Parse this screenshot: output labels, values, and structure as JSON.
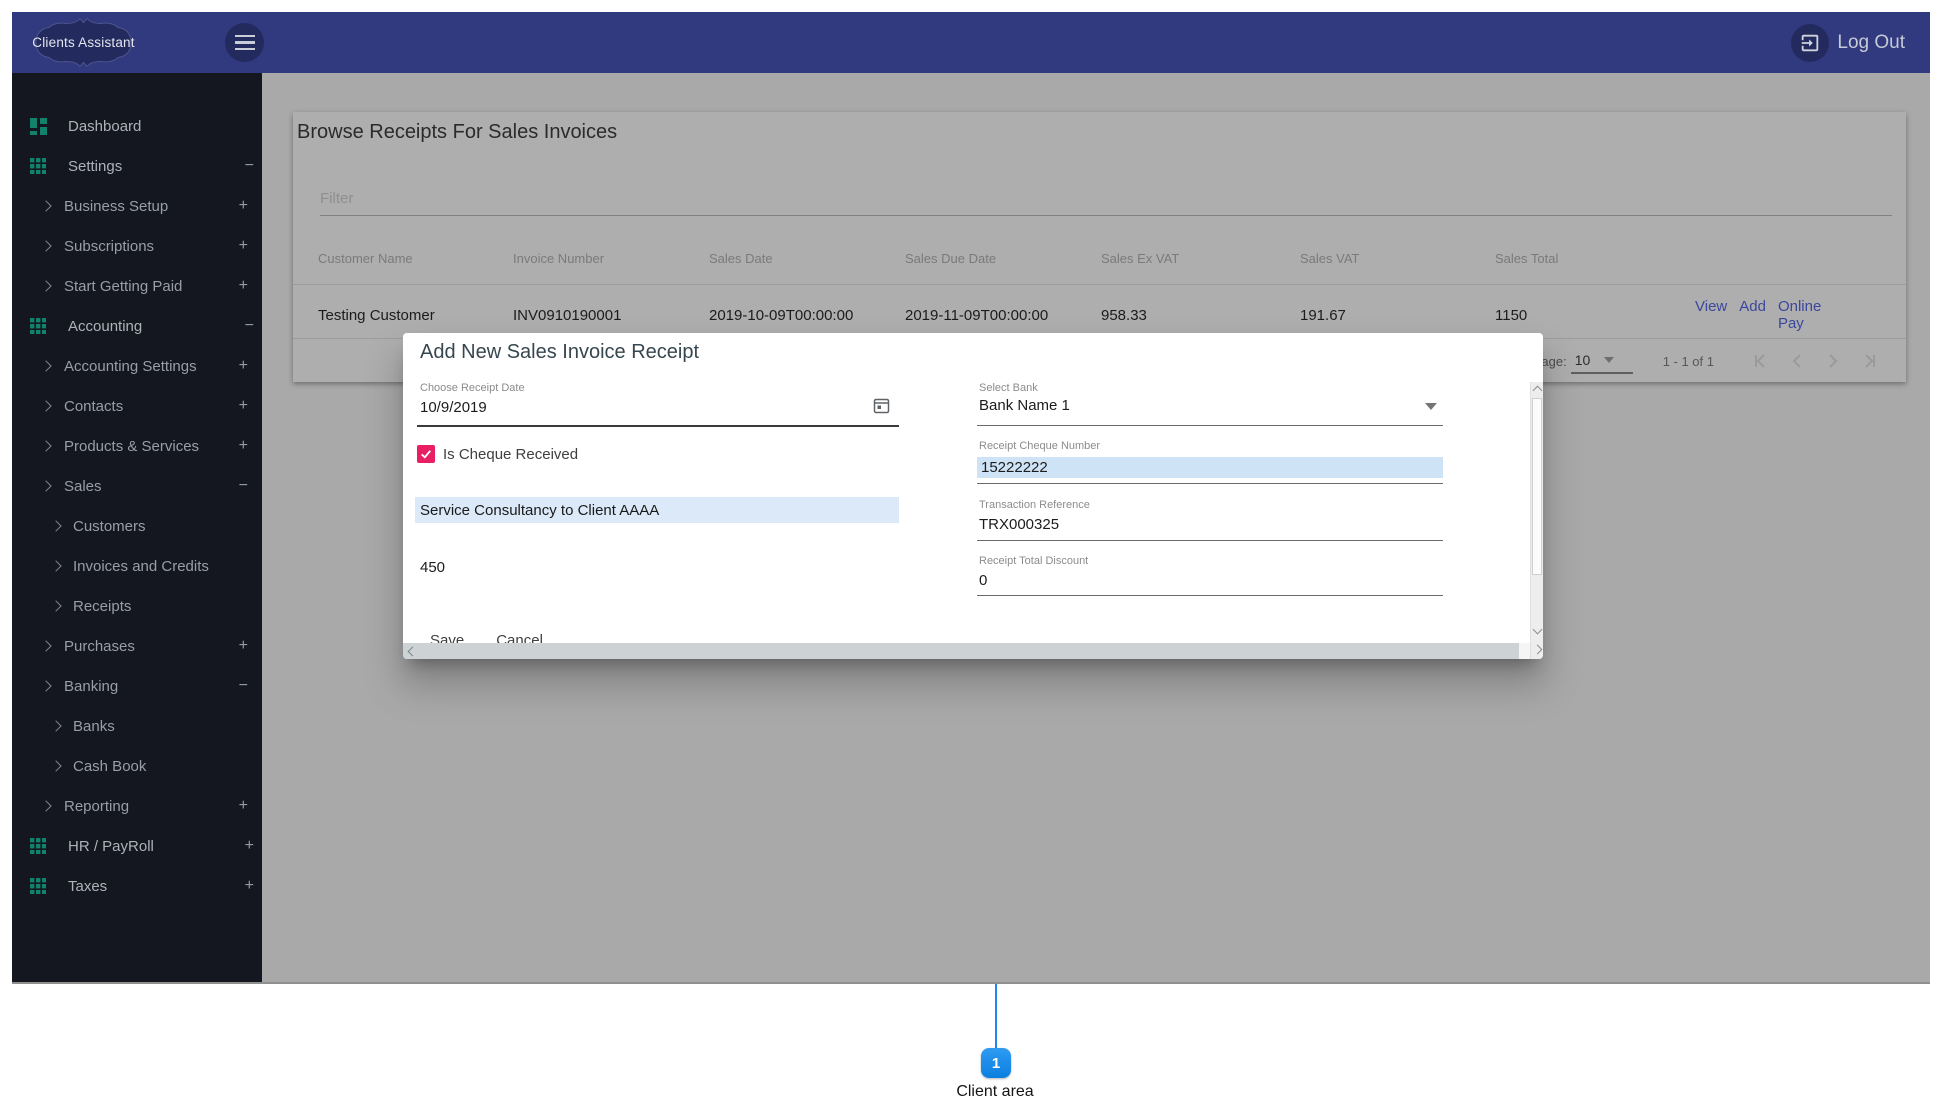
{
  "topbar": {
    "brand": "Clients Assistant",
    "logout_label": "Log Out"
  },
  "sidebar": {
    "items": [
      {
        "label": "Dashboard",
        "level": 0,
        "icon": "dashboard",
        "toggle": ""
      },
      {
        "label": "Settings",
        "level": 0,
        "icon": "apps",
        "toggle": "minus"
      },
      {
        "label": "Business Setup",
        "level": 1,
        "icon": "chevron",
        "toggle": "plus"
      },
      {
        "label": "Subscriptions",
        "level": 1,
        "icon": "chevron",
        "toggle": "plus"
      },
      {
        "label": "Start Getting Paid",
        "level": 1,
        "icon": "chevron",
        "toggle": "plus"
      },
      {
        "label": "Accounting",
        "level": 0,
        "icon": "apps",
        "toggle": "minus"
      },
      {
        "label": "Accounting Settings",
        "level": 1,
        "icon": "chevron",
        "toggle": "plus"
      },
      {
        "label": "Contacts",
        "level": 1,
        "icon": "chevron",
        "toggle": "plus"
      },
      {
        "label": "Products & Services",
        "level": 1,
        "icon": "chevron",
        "toggle": "plus"
      },
      {
        "label": "Sales",
        "level": 1,
        "icon": "chevron",
        "toggle": "minus"
      },
      {
        "label": "Customers",
        "level": 2,
        "icon": "chevron",
        "toggle": ""
      },
      {
        "label": "Invoices and Credits",
        "level": 2,
        "icon": "chevron",
        "toggle": ""
      },
      {
        "label": "Receipts",
        "level": 2,
        "icon": "chevron",
        "toggle": ""
      },
      {
        "label": "Purchases",
        "level": 1,
        "icon": "chevron",
        "toggle": "plus"
      },
      {
        "label": "Banking",
        "level": 1,
        "icon": "chevron",
        "toggle": "minus"
      },
      {
        "label": "Banks",
        "level": 2,
        "icon": "chevron",
        "toggle": ""
      },
      {
        "label": "Cash Book",
        "level": 2,
        "icon": "chevron",
        "toggle": ""
      },
      {
        "label": "Reporting",
        "level": 1,
        "icon": "chevron",
        "toggle": "plus"
      },
      {
        "label": "HR / PayRoll",
        "level": 0,
        "icon": "apps",
        "toggle": "plus"
      },
      {
        "label": "Taxes",
        "level": 0,
        "icon": "apps",
        "toggle": "plus"
      }
    ]
  },
  "page": {
    "title": "Browse Receipts For Sales Invoices"
  },
  "filter": {
    "placeholder": "Filter"
  },
  "table": {
    "columns": [
      "Customer Name",
      "Invoice Number",
      "Sales Date",
      "Sales Due Date",
      "Sales Ex VAT",
      "Sales VAT",
      "Sales Total"
    ],
    "row": {
      "customer_name": "Testing Customer",
      "invoice_number": "INV0910190001",
      "sales_date": "2019-10-09T00:00:00",
      "sales_due_date": "2019-11-09T00:00:00",
      "sales_ex_vat": "958.33",
      "sales_vat": "191.67",
      "sales_total": "1150"
    },
    "actions": [
      "View",
      "Add",
      "Online Pay"
    ]
  },
  "paginator": {
    "items_per_page_label": "Items per page:",
    "page_size": "10",
    "range_label": "1 - 1 of 1"
  },
  "modal": {
    "title": "Add New Sales Invoice Receipt",
    "receipt_date": {
      "label": "Choose Receipt Date",
      "value": "10/9/2019"
    },
    "bank": {
      "label": "Select Bank",
      "value": "Bank Name 1"
    },
    "cheque_checkbox_label": "Is Cheque Received",
    "cheque_number": {
      "label": "Receipt Cheque Number",
      "value": "15222222"
    },
    "transaction_reference": {
      "label": "Transaction Reference",
      "value": "TRX000325"
    },
    "total_discount": {
      "label": "Receipt Total Discount",
      "value": "0"
    },
    "line_item": {
      "description": "Service Consultancy to Client AAAA",
      "amount": "450"
    },
    "save_label": "Save",
    "cancel_label": "Cancel"
  },
  "annotation": {
    "number": "1",
    "label": "Client area"
  },
  "colors": {
    "topbar_indigo": "#31397f",
    "sidebar_bg": "#14171f",
    "teal_icon": "#13826c",
    "backdrop_gray": "#a9a9a9",
    "card_gray": "#aeaeae",
    "link_indigo": "#3a479c",
    "checkbox_pink": "#e91e63",
    "highlight_blue": "#dbe9f9",
    "annotation_blue": "#1086e8"
  }
}
